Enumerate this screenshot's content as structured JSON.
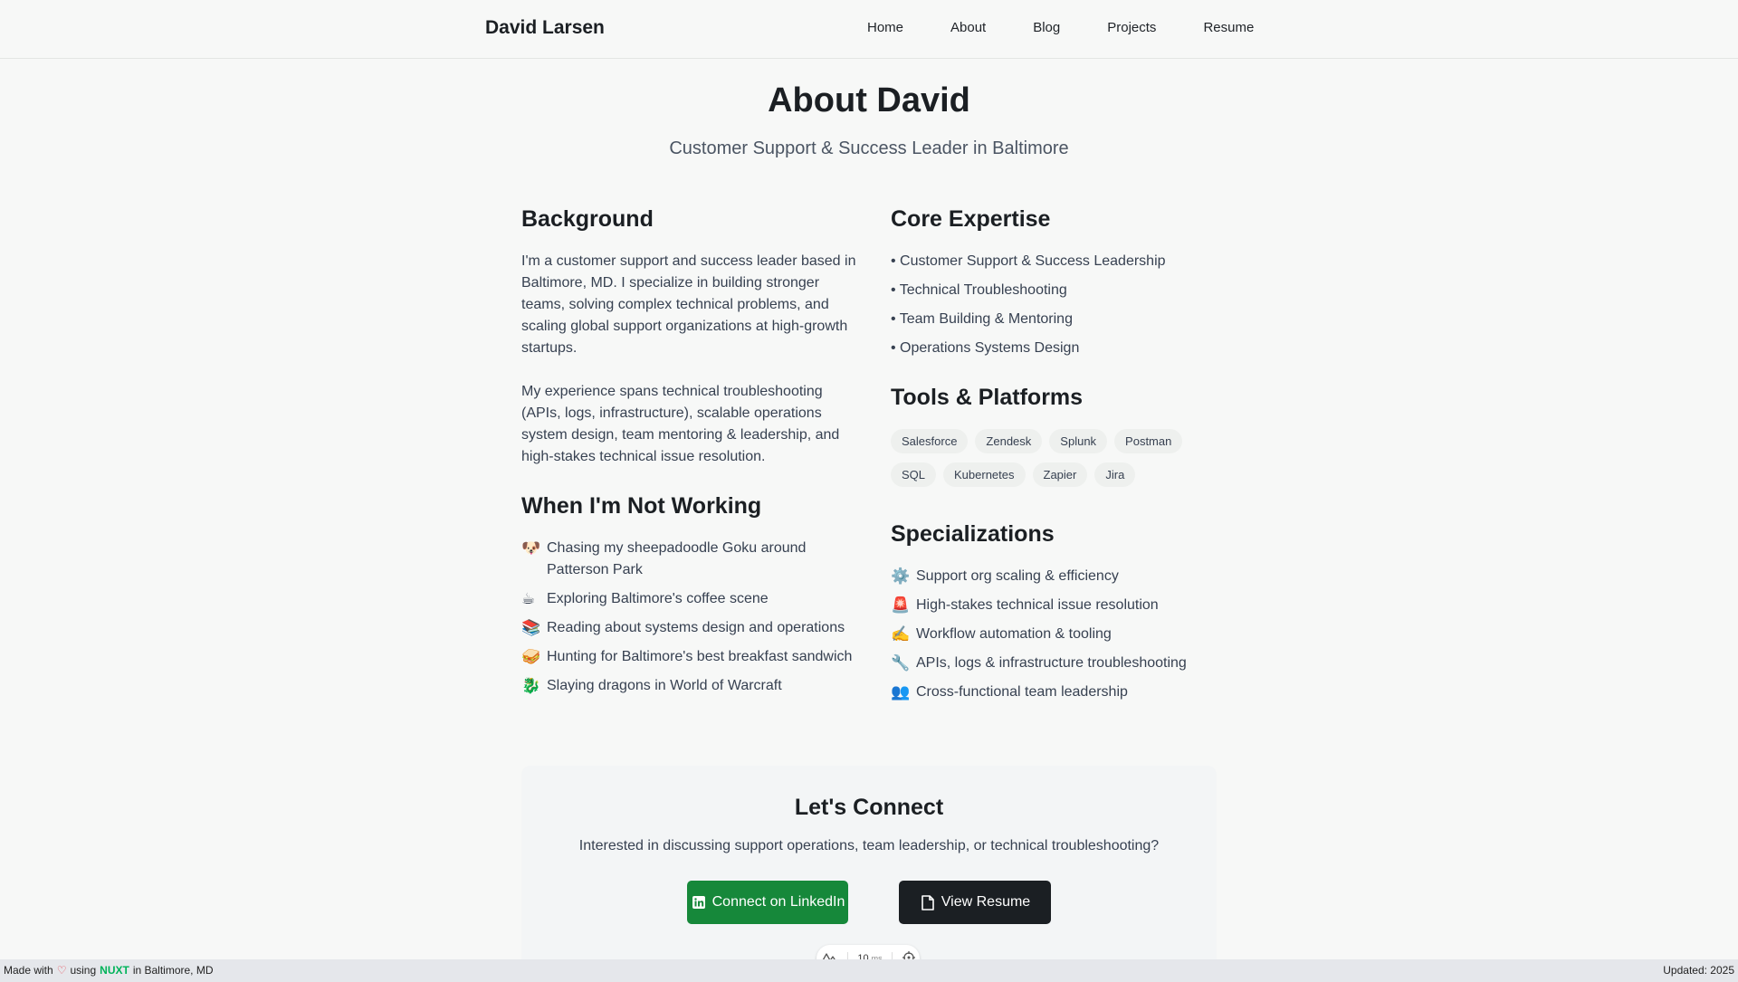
{
  "header": {
    "brand": "David Larsen",
    "nav": [
      "Home",
      "About",
      "Blog",
      "Projects",
      "Resume"
    ]
  },
  "page": {
    "title": "About David",
    "subtitle": "Customer Support & Success Leader in Baltimore"
  },
  "background": {
    "heading": "Background",
    "paragraphs": [
      "I'm a customer support and success leader based in Baltimore, MD. I specialize in building stronger teams, solving complex technical problems, and scaling global support organizations at high-growth startups.",
      "My experience spans technical troubleshooting (APIs, logs, infrastructure), scalable operations system design, team mentoring & leadership, and high-stakes technical issue resolution."
    ]
  },
  "not_working": {
    "heading": "When I'm Not Working",
    "items": [
      {
        "icon": "🐶",
        "icon_name": "dog-icon",
        "text": "Chasing my sheepadoodle Goku around Patterson Park"
      },
      {
        "icon": "☕",
        "icon_name": "coffee-icon",
        "text": "Exploring Baltimore's coffee scene"
      },
      {
        "icon": "📚",
        "icon_name": "books-icon",
        "text": "Reading about systems design and operations"
      },
      {
        "icon": "🥪",
        "icon_name": "sandwich-icon",
        "text": "Hunting for Baltimore's best breakfast sandwich"
      },
      {
        "icon": "🐉",
        "icon_name": "dragon-icon",
        "text": "Slaying dragons in World of Warcraft"
      }
    ]
  },
  "expertise": {
    "heading": "Core Expertise",
    "items": [
      "• Customer Support & Success Leadership",
      "• Technical Troubleshooting",
      "• Team Building & Mentoring",
      "• Operations Systems Design"
    ]
  },
  "tools": {
    "heading": "Tools & Platforms",
    "items": [
      "Salesforce",
      "Zendesk",
      "Splunk",
      "Postman",
      "SQL",
      "Kubernetes",
      "Zapier",
      "Jira"
    ]
  },
  "specializations": {
    "heading": "Specializations",
    "items": [
      {
        "icon": "⚙️",
        "icon_name": "gear-icon",
        "text": "Support org scaling & efficiency"
      },
      {
        "icon": "🚨",
        "icon_name": "siren-icon",
        "text": "High-stakes technical issue resolution"
      },
      {
        "icon": "✍️",
        "icon_name": "writing-hand-icon",
        "text": "Workflow automation & tooling"
      },
      {
        "icon": "🔧",
        "icon_name": "wrench-icon",
        "text": "APIs, logs & infrastructure troubleshooting"
      },
      {
        "icon": "👥",
        "icon_name": "people-icon",
        "text": "Cross-functional team leadership"
      }
    ]
  },
  "connect": {
    "heading": "Let's Connect",
    "text": "Interested in discussing support operations, team leadership, or technical troubleshooting?",
    "linkedin_label": "Connect on LinkedIn",
    "resume_label": "View Resume"
  },
  "devtools": {
    "timing": "10",
    "unit": "ms"
  },
  "footer": {
    "made_with": "Made with",
    "using": "using",
    "framework": "NUXT",
    "location": "in Baltimore, MD",
    "updated": "Updated: 2025"
  },
  "colors": {
    "linkedin_button": "#16883a",
    "resume_button": "#1b1f23",
    "nuxt": "#00b35a"
  }
}
